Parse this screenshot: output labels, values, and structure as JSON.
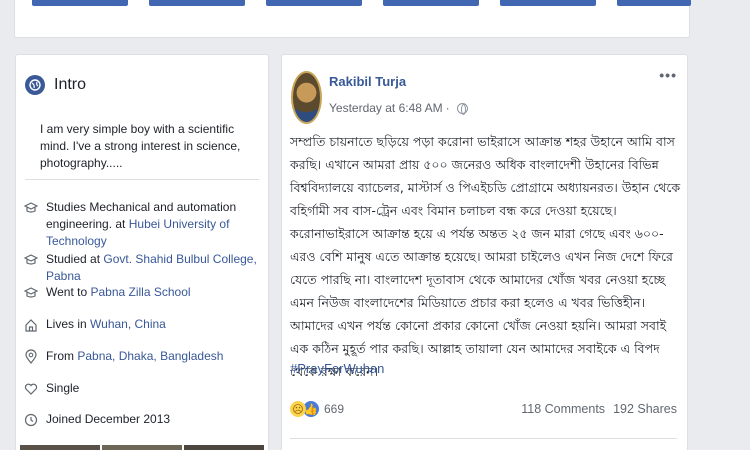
{
  "intro": {
    "title": "Intro",
    "bio": "I am very simple boy with a scientific mind. I've a strong interest in science, photography.....",
    "items": [
      {
        "icon": "graduation-cap-icon",
        "prefix": "Studies Mechanical and automation engineering. at ",
        "link": "Hubei University of Technology"
      },
      {
        "icon": "graduation-cap-icon",
        "prefix": "Studied at ",
        "link": "Govt. Shahid Bulbul College, Pabna"
      },
      {
        "icon": "graduation-cap-icon",
        "prefix": "Went to ",
        "link": "Pabna Zilla School"
      },
      {
        "icon": "home-icon",
        "prefix": "Lives in ",
        "link": "Wuhan, China"
      },
      {
        "icon": "location-pin-icon",
        "prefix": "From ",
        "link": "Pabna, Dhaka, Bangladesh"
      },
      {
        "icon": "heart-icon",
        "prefix": "Single",
        "link": ""
      },
      {
        "icon": "clock-icon",
        "prefix": "Joined December 2013",
        "link": ""
      }
    ]
  },
  "post": {
    "author": "Rakibil Turja",
    "time": "Yesterday at 6:48 AM",
    "separator": "·",
    "more": "•••",
    "body": "সম্প্রতি চায়নাতে ছড়িয়ে পড়া করোনা ভাইরাসে আক্রান্ত শহর উহানে আমি বাস করছি। এখানে আমরা প্রায় ৫০০ জনেরও অধিক বাংলাদেশী উহানের বিভিন্ন বিশ্ববিদ্যালয়ে ব্যাচেলর, মাস্টার্স ও পিএইচডি প্রোগ্রামে অধ্যায়নরত। উহান থেকে বহির্গামী সব বাস-ট্রেন এবং বিমান চলাচল বন্ধ করে দেওয়া হয়েছে। করোনাভাইরাসে আক্রান্ত হয়ে এ পর্যন্ত অন্তত ২৫ জন মারা গেছে এবং ৬০০-এরও বেশি মানুষ এতে আক্রান্ত হয়েছে। আমরা চাইলেও এখন নিজ দেশে ফিরে যেতে পারছি না। বাংলাদেশ দূতাবাস থেকে আমাদের খোঁজ খবর নেওয়া হচ্ছে এমন নিউজ বাংলাদেশের মিডিয়াতে প্রচার করা হলেও এ খবর ভিত্তিহীন। আমাদের এখন পর্যন্ত কোনো প্রকার কোনো খোঁজ নেওয়া হয়নি। আমরা সবাই এক কঠিন মুহূর্ত পার করছি। আল্লাহ তায়ালা যেন আমাদের সবাইকে এ বিপদ থেকে রক্ষা করেন।",
    "hashtag": "#PrayForWuhan",
    "reactions": "669",
    "comments": "118 Comments",
    "shares": "192 Shares"
  },
  "colors": {
    "brand": "#4267b2",
    "link": "#385898",
    "background": "#e9ebee"
  }
}
